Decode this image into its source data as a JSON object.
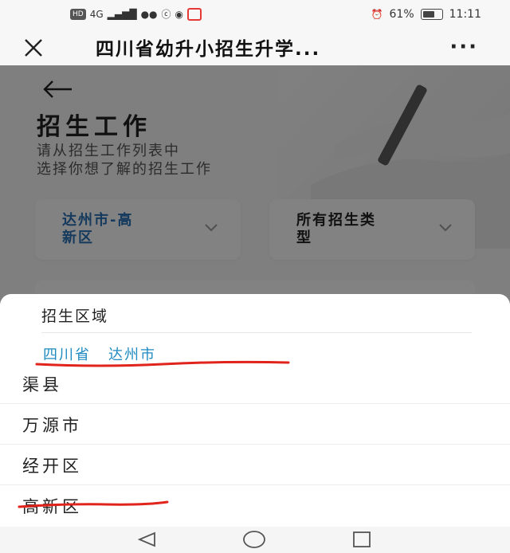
{
  "status_bar": {
    "network_badge": "HD",
    "network_type": "4G",
    "battery_percent": "61%",
    "time": "11:11"
  },
  "title_bar": {
    "title": "四川省幼升小招生升学..."
  },
  "page": {
    "heading": "招生工作",
    "description_line1": "请从招生工作列表中",
    "description_line2": "选择你想了解的招生工作",
    "filter_region_line1": "达州市-高",
    "filter_region_line2": "新区",
    "filter_type_line1": "所有招生类",
    "filter_type_line2": "型"
  },
  "sheet": {
    "title": "招生区域",
    "breadcrumbs": [
      "四川省",
      "达州市"
    ],
    "options": [
      "渠县",
      "万源市",
      "经开区",
      "高新区"
    ]
  },
  "colors": {
    "accent_blue": "#1f8ac0",
    "annotation_red": "#e0241b",
    "overlay": "#000000"
  }
}
